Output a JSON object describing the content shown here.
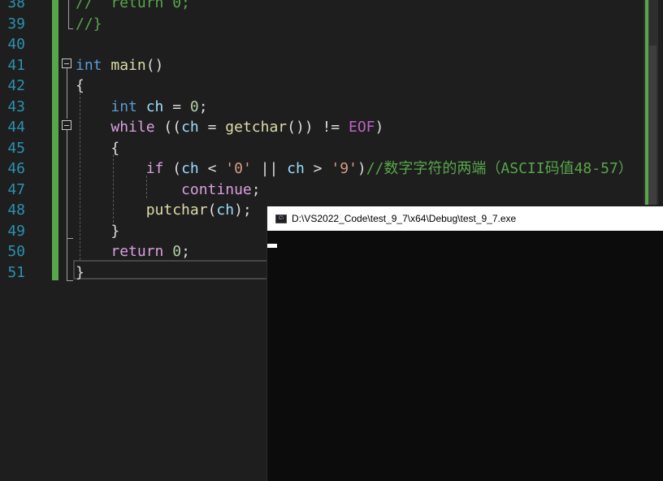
{
  "editor": {
    "line_numbers": [
      "38",
      "39",
      "40",
      "41",
      "42",
      "43",
      "44",
      "45",
      "46",
      "47",
      "48",
      "49",
      "50",
      "51"
    ],
    "lines": [
      [
        {
          "t": "//  return 0;",
          "c": "cm"
        }
      ],
      [
        {
          "t": "//}",
          "c": "cm"
        }
      ],
      [],
      [
        {
          "t": "int",
          "c": "kw"
        },
        {
          "t": " ",
          "c": "plain"
        },
        {
          "t": "main",
          "c": "fn"
        },
        {
          "t": "()",
          "c": "plain"
        }
      ],
      [
        {
          "t": "{",
          "c": "plain"
        }
      ],
      [
        {
          "t": "    ",
          "c": "plain"
        },
        {
          "t": "int",
          "c": "kw"
        },
        {
          "t": " ",
          "c": "plain"
        },
        {
          "t": "ch",
          "c": "var"
        },
        {
          "t": " = ",
          "c": "plain"
        },
        {
          "t": "0",
          "c": "num"
        },
        {
          "t": ";",
          "c": "plain"
        }
      ],
      [
        {
          "t": "    ",
          "c": "plain"
        },
        {
          "t": "while",
          "c": "kw2"
        },
        {
          "t": " ((",
          "c": "plain"
        },
        {
          "t": "ch",
          "c": "var"
        },
        {
          "t": " = ",
          "c": "plain"
        },
        {
          "t": "getchar",
          "c": "fn"
        },
        {
          "t": "()) != ",
          "c": "plain"
        },
        {
          "t": "EOF",
          "c": "mac"
        },
        {
          "t": ")",
          "c": "plain"
        }
      ],
      [
        {
          "t": "    {",
          "c": "plain"
        }
      ],
      [
        {
          "t": "        ",
          "c": "plain"
        },
        {
          "t": "if",
          "c": "kw2"
        },
        {
          "t": " (",
          "c": "plain"
        },
        {
          "t": "ch",
          "c": "var"
        },
        {
          "t": " < ",
          "c": "plain"
        },
        {
          "t": "'0'",
          "c": "str"
        },
        {
          "t": " || ",
          "c": "plain"
        },
        {
          "t": "ch",
          "c": "var"
        },
        {
          "t": " > ",
          "c": "plain"
        },
        {
          "t": "'9'",
          "c": "str"
        },
        {
          "t": ")",
          "c": "plain"
        },
        {
          "t": "//数字字符的两端（ASCII码值48-57）",
          "c": "cm"
        }
      ],
      [
        {
          "t": "            ",
          "c": "plain"
        },
        {
          "t": "continue",
          "c": "kw2"
        },
        {
          "t": ";",
          "c": "plain"
        }
      ],
      [
        {
          "t": "        ",
          "c": "plain"
        },
        {
          "t": "putchar",
          "c": "fn"
        },
        {
          "t": "(",
          "c": "plain"
        },
        {
          "t": "ch",
          "c": "var"
        },
        {
          "t": ");",
          "c": "plain"
        }
      ],
      [
        {
          "t": "    }",
          "c": "plain"
        }
      ],
      [
        {
          "t": "    ",
          "c": "plain"
        },
        {
          "t": "return",
          "c": "kw2"
        },
        {
          "t": " ",
          "c": "plain"
        },
        {
          "t": "0",
          "c": "num"
        },
        {
          "t": ";",
          "c": "plain"
        }
      ],
      [
        {
          "t": "}",
          "c": "plain"
        }
      ]
    ],
    "colors": {
      "background": "#1e1e1e",
      "line_number": "#2b91af",
      "keyword": "#569cd6",
      "control_keyword": "#d8a0df",
      "function": "#dcdcaa",
      "variable": "#9cdcfe",
      "number": "#b5cea8",
      "string": "#d69d85",
      "comment": "#57a64a",
      "macro": "#bd63c5",
      "change_marker": "#57a64a"
    }
  },
  "console_window": {
    "icon": "console-app-icon",
    "title": "D:\\VS2022_Code\\test_9_7\\x64\\Debug\\test_9_7.exe",
    "background": "#0c0c0c",
    "output": ""
  }
}
